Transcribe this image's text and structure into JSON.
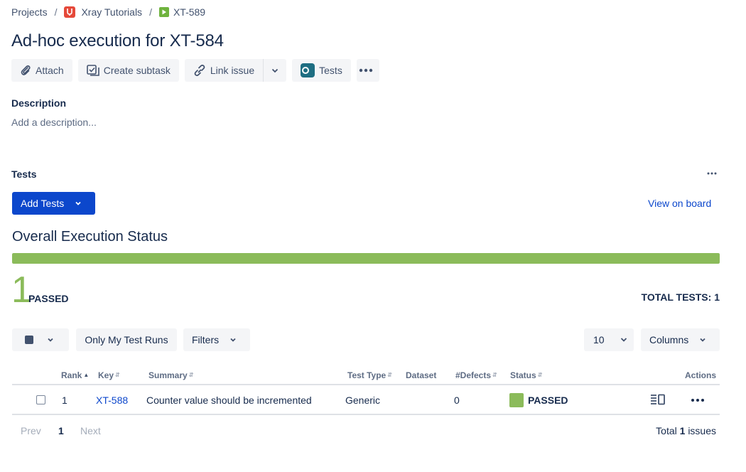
{
  "breadcrumb": {
    "items": [
      "Projects",
      "Xray Tutorials",
      "XT-589"
    ],
    "separator": "/"
  },
  "issue": {
    "title": "Ad-hoc execution for XT-584"
  },
  "toolbar": {
    "attach_label": "Attach",
    "create_subtask_label": "Create subtask",
    "link_issue_label": "Link issue",
    "tests_label": "Tests"
  },
  "description": {
    "label": "Description",
    "placeholder": "Add a description..."
  },
  "tests_section": {
    "label": "Tests",
    "add_tests_label": "Add Tests",
    "view_on_board_label": "View on board"
  },
  "execution_status": {
    "title": "Overall Execution Status",
    "passed_count": "1",
    "passed_label": "PASSED",
    "total_tests_label": "TOTAL TESTS: 1",
    "passed_fraction": 1.0,
    "passed_color": "#8bbb5a"
  },
  "filters": {
    "only_my_runs_label": "Only My Test Runs",
    "filters_label": "Filters",
    "page_size": "10",
    "columns_label": "Columns"
  },
  "table": {
    "columns": [
      "Rank",
      "Key",
      "Summary",
      "Test Type",
      "Dataset",
      "#Defects",
      "Status",
      "Actions"
    ],
    "rows": [
      {
        "rank": "1",
        "key": "XT-588",
        "summary": "Counter value should be incremented",
        "test_type": "Generic",
        "dataset": "",
        "defects": "0",
        "status": "PASSED"
      }
    ]
  },
  "pagination": {
    "prev_label": "Prev",
    "current_page": "1",
    "next_label": "Next",
    "total_prefix": "Total",
    "total_count": "1",
    "total_suffix": "issues"
  },
  "colors": {
    "primary": "#0c47cc",
    "pass": "#8bbb5a",
    "text": "#172b4d"
  }
}
